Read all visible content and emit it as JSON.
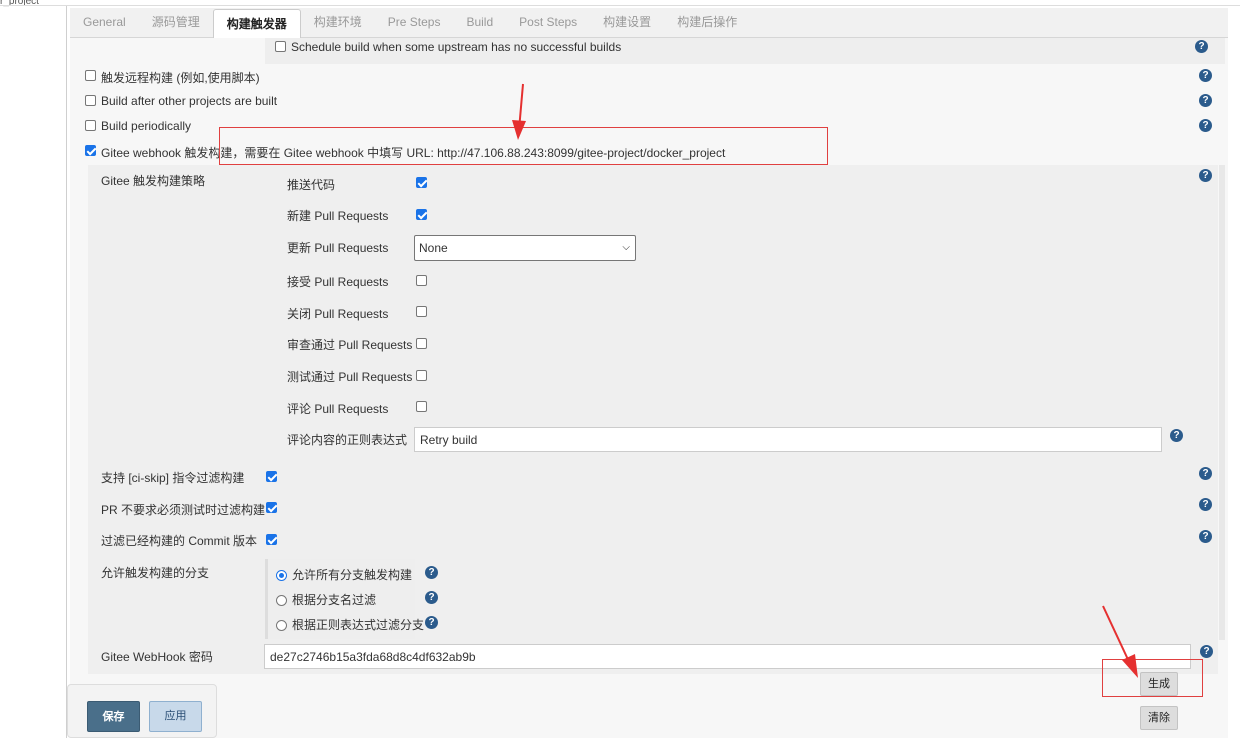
{
  "breadcrumb": "r_project",
  "tabs": [
    "General",
    "源码管理",
    "构建触发器",
    "构建环境",
    "Pre Steps",
    "Build",
    "Post Steps",
    "构建设置",
    "构建后操作"
  ],
  "active_tab": "构建触发器",
  "upstream_option": "Schedule build when some upstream has no successful builds",
  "triggers": {
    "remote": "触发远程构建 (例如,使用脚本)",
    "after_other": "Build after other projects are built",
    "periodic": "Build periodically",
    "gitee": "Gitee webhook 触发构建，需要在 Gitee webhook 中填写 URL: http://47.106.88.243:8099/gitee-project/docker_project"
  },
  "strategy": {
    "title": "Gitee 触发构建策略",
    "push": "推送代码",
    "new_pr": "新建 Pull Requests",
    "update_pr": "更新 Pull Requests",
    "update_pr_value": "None",
    "accept_pr": "接受 Pull Requests",
    "close_pr": "关闭 Pull Requests",
    "review_pr": "审查通过 Pull Requests",
    "test_pr": "测试通过 Pull Requests",
    "comment_pr": "评论 Pull Requests",
    "comment_regex": "评论内容的正则表达式",
    "comment_regex_value": "Retry build"
  },
  "options": {
    "ci_skip": "支持 [ci-skip] 指令过滤构建",
    "pr_filter": "PR 不要求必须测试时过滤构建",
    "commit_filter": "过滤已经构建的 Commit 版本"
  },
  "branch": {
    "title": "允许触发构建的分支",
    "all": "允许所有分支触发构建",
    "by_name": "根据分支名过滤",
    "by_regex": "根据正则表达式过滤分支"
  },
  "webhook": {
    "label": "Gitee WebHook 密码",
    "value": "de27c2746b15a3fda68d8c4df632ab9b"
  },
  "buttons": {
    "generate": "生成",
    "clear": "清除",
    "save": "保存",
    "apply": "应用"
  },
  "icons": {
    "help": "?"
  }
}
